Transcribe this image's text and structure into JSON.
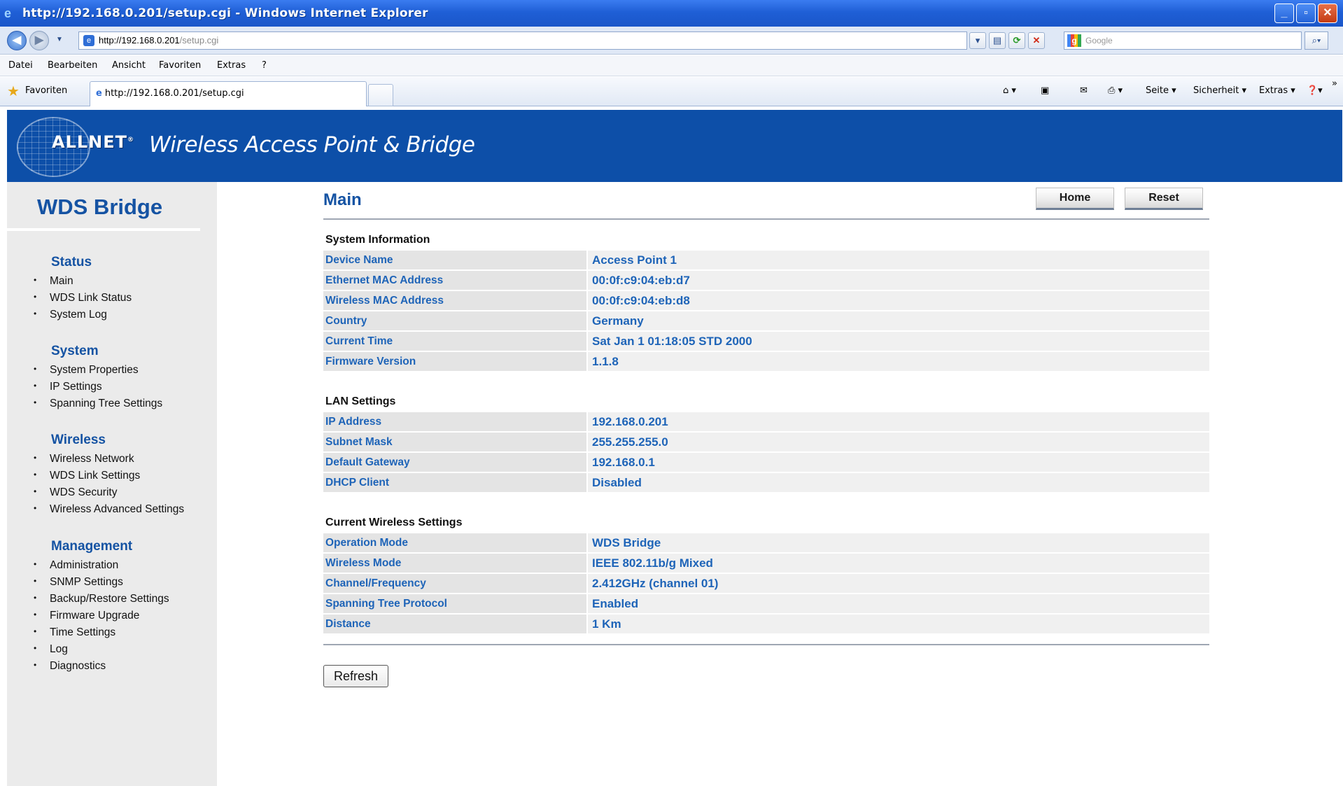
{
  "browser": {
    "window_title": "http://192.168.0.201/setup.cgi - Windows Internet Explorer",
    "address_host": "http://192.168.0.201",
    "address_path": "/setup.cgi",
    "search_placeholder": "Google",
    "menu": [
      "Datei",
      "Bearbeiten",
      "Ansicht",
      "Favoriten",
      "Extras",
      "?"
    ],
    "favorites_label": "Favoriten",
    "tab_title": "http://192.168.0.201/setup.cgi",
    "command_bar": {
      "page": "Seite",
      "security": "Sicherheit",
      "tools": "Extras"
    }
  },
  "banner": {
    "brand": "ALLNET",
    "product": "Wireless Access Point & Bridge"
  },
  "sidebar": {
    "mode": "WDS Bridge",
    "groups": [
      {
        "title": "Status",
        "items": [
          "Main",
          "WDS Link Status",
          "System Log"
        ]
      },
      {
        "title": "System",
        "items": [
          "System Properties",
          "IP Settings",
          "Spanning Tree Settings"
        ]
      },
      {
        "title": "Wireless",
        "items": [
          "Wireless Network",
          "WDS Link Settings",
          "WDS Security",
          "Wireless Advanced Settings"
        ]
      },
      {
        "title": "Management",
        "items": [
          "Administration",
          "SNMP Settings",
          "Backup/Restore Settings",
          "Firmware Upgrade",
          "Time Settings",
          "Log",
          "Diagnostics"
        ]
      }
    ]
  },
  "main": {
    "title": "Main",
    "home_button": "Home",
    "reset_button": "Reset",
    "refresh_button": "Refresh",
    "sections": [
      {
        "title": "System Information",
        "rows": [
          {
            "label": "Device Name",
            "value": "Access Point 1"
          },
          {
            "label": "Ethernet MAC Address",
            "value": "00:0f:c9:04:eb:d7"
          },
          {
            "label": "Wireless MAC Address",
            "value": "00:0f:c9:04:eb:d8"
          },
          {
            "label": "Country",
            "value": "Germany"
          },
          {
            "label": "Current Time",
            "value": "Sat Jan 1 01:18:05 STD 2000"
          },
          {
            "label": "Firmware Version",
            "value": "1.1.8"
          }
        ]
      },
      {
        "title": "LAN Settings",
        "rows": [
          {
            "label": "IP Address",
            "value": "192.168.0.201"
          },
          {
            "label": "Subnet Mask",
            "value": "255.255.255.0"
          },
          {
            "label": "Default Gateway",
            "value": "192.168.0.1"
          },
          {
            "label": "DHCP Client",
            "value": "Disabled"
          }
        ]
      },
      {
        "title": "Current Wireless Settings",
        "rows": [
          {
            "label": "Operation Mode",
            "value": "WDS Bridge"
          },
          {
            "label": "Wireless Mode",
            "value": "IEEE 802.11b/g Mixed"
          },
          {
            "label": "Channel/Frequency",
            "value": "2.412GHz (channel 01)"
          },
          {
            "label": "Spanning Tree Protocol",
            "value": "Enabled"
          },
          {
            "label": "Distance",
            "value": "1 Km"
          }
        ]
      }
    ]
  }
}
